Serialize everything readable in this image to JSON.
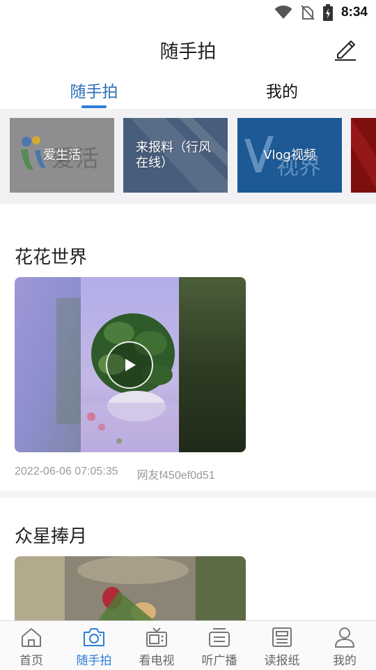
{
  "status_bar": {
    "time": "8:34"
  },
  "header": {
    "title": "随手拍"
  },
  "tabs": [
    {
      "label": "随手拍",
      "active": true
    },
    {
      "label": "我的",
      "active": false
    }
  ],
  "categories": [
    {
      "label": "爱生活"
    },
    {
      "label": "来报料（行风在线）"
    },
    {
      "label": "Vlog视频"
    }
  ],
  "posts": [
    {
      "title": "花花世界",
      "date": "2022-06-06 07:05:35",
      "author": "网友f450ef0d51"
    },
    {
      "title": "众星捧月"
    }
  ],
  "bottom_nav": [
    {
      "label": "首页",
      "icon": "home-icon",
      "active": false
    },
    {
      "label": "随手拍",
      "icon": "camera-icon",
      "active": true
    },
    {
      "label": "看电视",
      "icon": "tv-icon",
      "active": false
    },
    {
      "label": "听广播",
      "icon": "radio-icon",
      "active": false
    },
    {
      "label": "读报纸",
      "icon": "newspaper-icon",
      "active": false
    },
    {
      "label": "我的",
      "icon": "user-icon",
      "active": false
    }
  ],
  "colors": {
    "accent": "#2c7fd6",
    "active_tab_text": "#2c6fb5",
    "meta_text": "#999999"
  }
}
